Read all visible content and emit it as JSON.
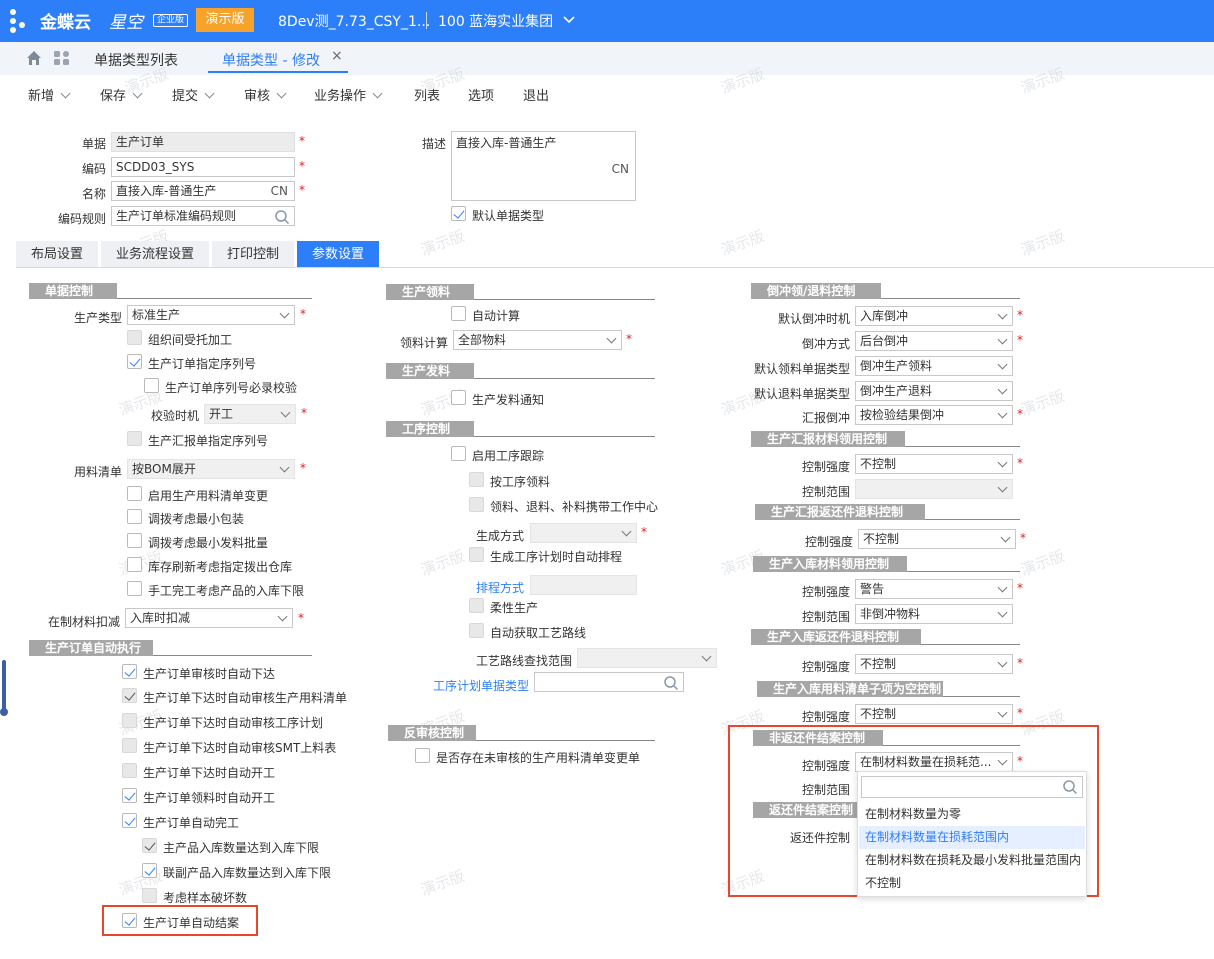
{
  "topbar": {
    "brand": "金蝶云",
    "brand_sub": "星空",
    "edition": "企业版",
    "demo": "演示版",
    "org": "8Dev测_7.73_CSY_1...",
    "group": "100 蓝海实业集团"
  },
  "tabs": {
    "list": "单据类型列表",
    "active": "单据类型 - 修改"
  },
  "toolbar": {
    "new": "新增",
    "save": "保存",
    "submit": "提交",
    "audit": "审核",
    "biz": "业务操作",
    "list": "列表",
    "options": "选项",
    "exit": "退出"
  },
  "header": {
    "bill_label": "单据",
    "bill_value": "生产订单",
    "code_label": "编码",
    "code_value": "SCDD03_SYS",
    "name_label": "名称",
    "name_value": "直接入库-普通生产",
    "name_lang": "CN",
    "rule_label": "编码规则",
    "rule_value": "生产订单标准编码规则",
    "desc_label": "描述",
    "desc_value": "直接入库-普通生产",
    "desc_lang": "CN",
    "default_label": "默认单据类型"
  },
  "content_tabs": [
    "布局设置",
    "业务流程设置",
    "打印控制",
    "参数设置"
  ],
  "watermark": "演示版",
  "col1": {
    "sec_bill": "单据控制",
    "prod_type_label": "生产类型",
    "prod_type": "标准生产",
    "cb_interorg": "组织间受托加工",
    "cb_seq": "生产订单指定序列号",
    "cb_seq_check": "生产订单序列号必录校验",
    "check_time_label": "校验时机",
    "check_time": "开工",
    "cb_report_seq": "生产汇报单指定序列号",
    "bom_label": "用料清单",
    "bom": "按BOM展开",
    "cb_bom_change": "启用生产用料清单变更",
    "cb_min_pack": "调拨考虑最小包装",
    "cb_min_batch": "调拨考虑最小发料批量",
    "cb_refresh_wh": "库存刷新考虑指定拨出仓库",
    "cb_manual": "手工完工考虑产品的入库下限",
    "wip_label": "在制材料扣减",
    "wip": "入库时扣减",
    "sec_auto": "生产订单自动执行",
    "a1": "生产订单审核时自动下达",
    "a2": "生产订单下达时自动审核生产用料清单",
    "a3": "生产订单下达时自动审核工序计划",
    "a4": "生产订单下达时自动审核SMT上料表",
    "a5": "生产订单下达时自动开工",
    "a6": "生产订单领料时自动开工",
    "a7": "生产订单自动完工",
    "a8": "主产品入库数量达到入库下限",
    "a9": "联副产品入库数量达到入库下限",
    "a10": "考虑样本破坏数",
    "a11": "生产订单自动结案"
  },
  "col2": {
    "sec_pick": "生产领料",
    "cb_auto_calc": "自动计算",
    "pick_calc_label": "领料计算",
    "pick_calc": "全部物料",
    "sec_issue": "生产发料",
    "cb_issue_notice": "生产发料通知",
    "sec_route": "工序控制",
    "cb_route": "启用工序跟踪",
    "cb_by_route": "按工序领料",
    "cb_carry": "领料、退料、补料携带工作中心",
    "gen_label": "生成方式",
    "cb_auto_sched": "生成工序计划时自动排程",
    "sched_label": "排程方式",
    "cb_flex": "柔性生产",
    "cb_auto_route": "自动获取工艺路线",
    "route_range_label": "工艺路线查找范围",
    "plan_type_label": "工序计划单据类型",
    "sec_reaudit": "反审核控制",
    "cb_unaudited": "是否存在未审核的生产用料清单变更单"
  },
  "col3": {
    "sec_backflush": "倒冲领/退料控制",
    "bf_time_label": "默认倒冲时机",
    "bf_time": "入库倒冲",
    "bf_mode_label": "倒冲方式",
    "bf_mode": "后台倒冲",
    "pick_type_label": "默认领料单据类型",
    "pick_type": "倒冲生产领料",
    "ret_type_label": "默认退料单据类型",
    "ret_type": "倒冲生产退料",
    "report_bf_label": "汇报倒冲",
    "report_bf": "按检验结果倒冲",
    "sec_report_pick": "生产汇报材料领用控制",
    "strength_label": "控制强度",
    "range_label": "控制范围",
    "s1": "不控制",
    "sec_report_ret": "生产汇报返还件退料控制",
    "s2": "不控制",
    "sec_in_pick": "生产入库材料领用控制",
    "s3": "警告",
    "r3": "非倒冲物料",
    "sec_in_ret": "生产入库返还件退料控制",
    "s4": "不控制",
    "sec_in_empty": "生产入库用料清单子项为空控制",
    "s5": "不控制",
    "sec_nonret": "非返还件结案控制",
    "s6": "在制材料数量在损耗范...",
    "sec_ret_close": "返还件结案控制",
    "ret_ctrl_label": "返还件控制"
  },
  "dropdown": {
    "options": [
      "在制材料数量为零",
      "在制材料数量在损耗范围内",
      "在制材料数在损耗及最小发料批量范围内",
      "不控制"
    ],
    "selected_index": 1
  },
  "colors": {
    "accent": "#2d7ff9",
    "demo": "#f7a22b",
    "highlight": "#e5482f"
  }
}
